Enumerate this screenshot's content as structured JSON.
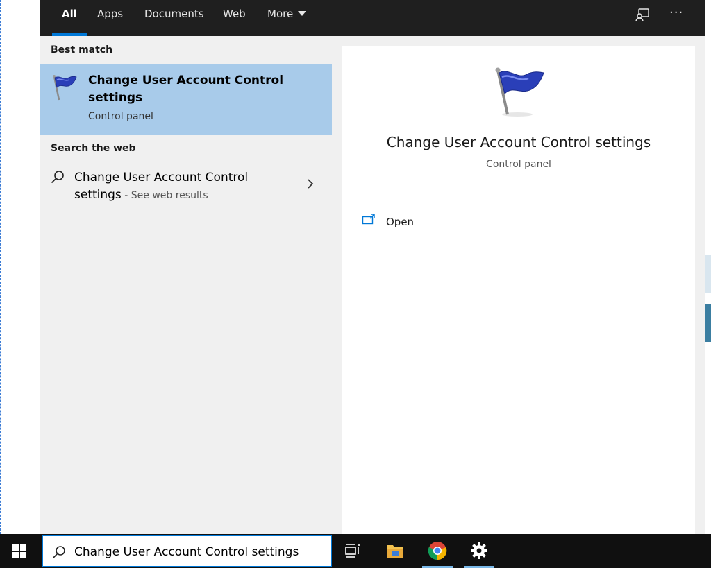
{
  "tabs": [
    {
      "label": "All",
      "active": true
    },
    {
      "label": "Apps"
    },
    {
      "label": "Documents"
    },
    {
      "label": "Web"
    },
    {
      "label": "More"
    }
  ],
  "toolbar": {
    "feedback_icon": "feedback-icon",
    "more_icon": "ellipsis-icon",
    "more_symbol": "···"
  },
  "best_match": {
    "section_label": "Best match",
    "title": "Change User Account Control settings",
    "subtitle": "Control panel",
    "icon": "uac-flag-icon"
  },
  "web": {
    "section_label": "Search the web",
    "query_text": "Change User Account Control settings",
    "suffix": " - See web results"
  },
  "preview": {
    "title": "Change User Account Control settings",
    "subtitle": "Control panel",
    "actions": [
      {
        "label": "Open",
        "icon": "open-icon"
      }
    ]
  },
  "taskbar": {
    "search_value": "Change User Account Control settings",
    "apps": [
      {
        "name": "task-view",
        "icon": "task-view-icon"
      },
      {
        "name": "file-explorer",
        "icon": "folder-icon"
      },
      {
        "name": "chrome",
        "icon": "chrome-icon"
      },
      {
        "name": "settings",
        "icon": "gear-icon"
      }
    ]
  },
  "colors": {
    "accent": "#0078d7",
    "selected_row": "#a8cbea",
    "tabbar": "#1f1f1f",
    "taskbar": "#101010"
  }
}
